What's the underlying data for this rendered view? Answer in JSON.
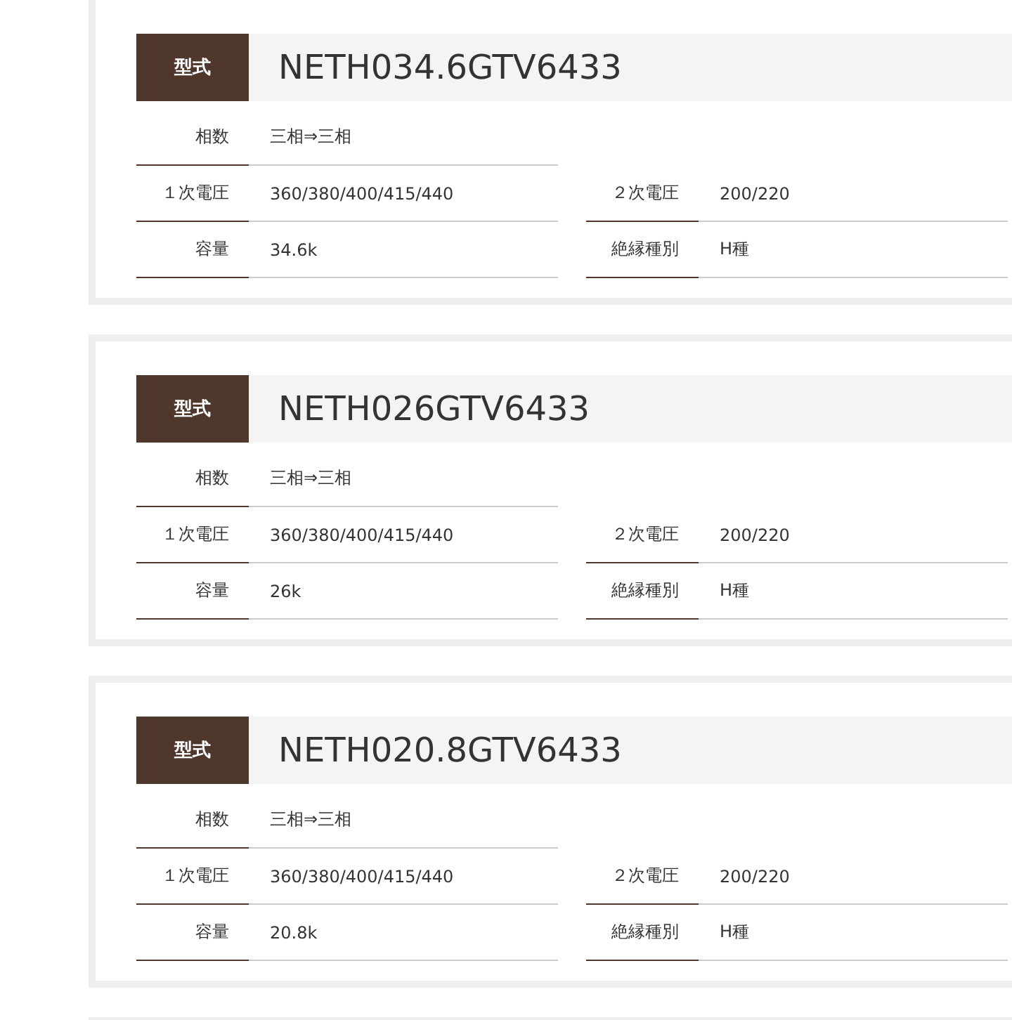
{
  "products": [
    {
      "model_label": "型式",
      "model": "NETH034.6GTV6433",
      "rows": [
        [
          {
            "label": "相数",
            "value": "三相⇒三相"
          }
        ],
        [
          {
            "label": "１次電圧",
            "value": "360/380/400/415/440"
          },
          {
            "label": "２次電圧",
            "value": "200/220"
          }
        ],
        [
          {
            "label": "容量",
            "value": "34.6k"
          },
          {
            "label": "絶縁種別",
            "value": "H種"
          }
        ]
      ]
    },
    {
      "model_label": "型式",
      "model": "NETH026GTV6433",
      "rows": [
        [
          {
            "label": "相数",
            "value": "三相⇒三相"
          }
        ],
        [
          {
            "label": "１次電圧",
            "value": "360/380/400/415/440"
          },
          {
            "label": "２次電圧",
            "value": "200/220"
          }
        ],
        [
          {
            "label": "容量",
            "value": "26k"
          },
          {
            "label": "絶縁種別",
            "value": "H種"
          }
        ]
      ]
    },
    {
      "model_label": "型式",
      "model": "NETH020.8GTV6433",
      "rows": [
        [
          {
            "label": "相数",
            "value": "三相⇒三相"
          }
        ],
        [
          {
            "label": "１次電圧",
            "value": "360/380/400/415/440"
          },
          {
            "label": "２次電圧",
            "value": "200/220"
          }
        ],
        [
          {
            "label": "容量",
            "value": "20.8k"
          },
          {
            "label": "絶縁種別",
            "value": "H種"
          }
        ]
      ]
    }
  ]
}
